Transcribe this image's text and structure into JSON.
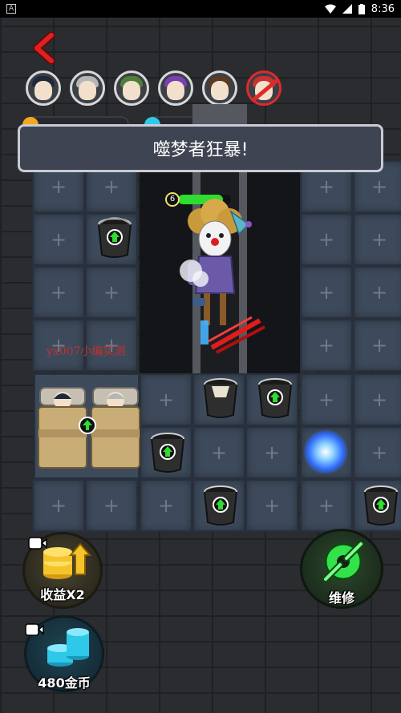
{
  "status_bar": {
    "time": "8:36",
    "app_badge": "A"
  },
  "characters": [
    {
      "id": "char-1",
      "hair": "#1e2a3a"
    },
    {
      "id": "char-2",
      "hair": "#b5b5b5"
    },
    {
      "id": "char-3",
      "hair": "#4f7d3a"
    },
    {
      "id": "char-4",
      "hair": "#7a3fb0"
    },
    {
      "id": "char-5",
      "hair": "#5a3a22"
    },
    {
      "id": "char-6",
      "hair": "#c83232",
      "disabled": true
    }
  ],
  "banner": {
    "text": "噬梦者狂暴!"
  },
  "enemy": {
    "level": "6",
    "hp_fraction": 0.85
  },
  "watermark": {
    "text": "yx007小编实测"
  },
  "buttons": {
    "income": {
      "label": "收益X2"
    },
    "coins": {
      "label": "480金币"
    },
    "repair": {
      "label": "维修"
    }
  },
  "colors": {
    "hp": "#2fdc2f",
    "upgrade_arrow": "#2fdc2f",
    "repair_icon": "#33e24a",
    "coins_icon": "#2ec8e8",
    "gold_icon": "#f4c52a",
    "back_arrow": "#e02020"
  }
}
